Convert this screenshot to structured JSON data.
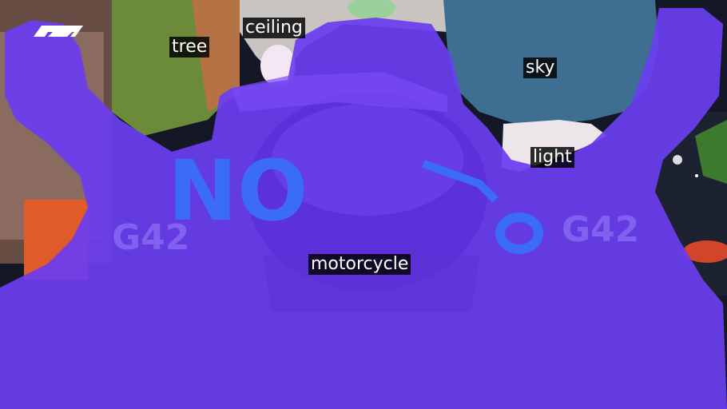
{
  "segments": {
    "ceiling": "ceiling",
    "tree": "tree",
    "sky": "sky",
    "light": "light",
    "motorcycle": "motorcycle"
  },
  "overlay": {
    "no_text": "NO",
    "brand_text": "G42"
  },
  "colors": {
    "mask": "#6a3df0",
    "sky": "#3e6e92",
    "tree": "#6b8a3a",
    "track_bg": "#111522",
    "brand_blue": "#3b6cf5",
    "logo_white": "#ffffff"
  },
  "icons": [
    "f1-logo"
  ]
}
